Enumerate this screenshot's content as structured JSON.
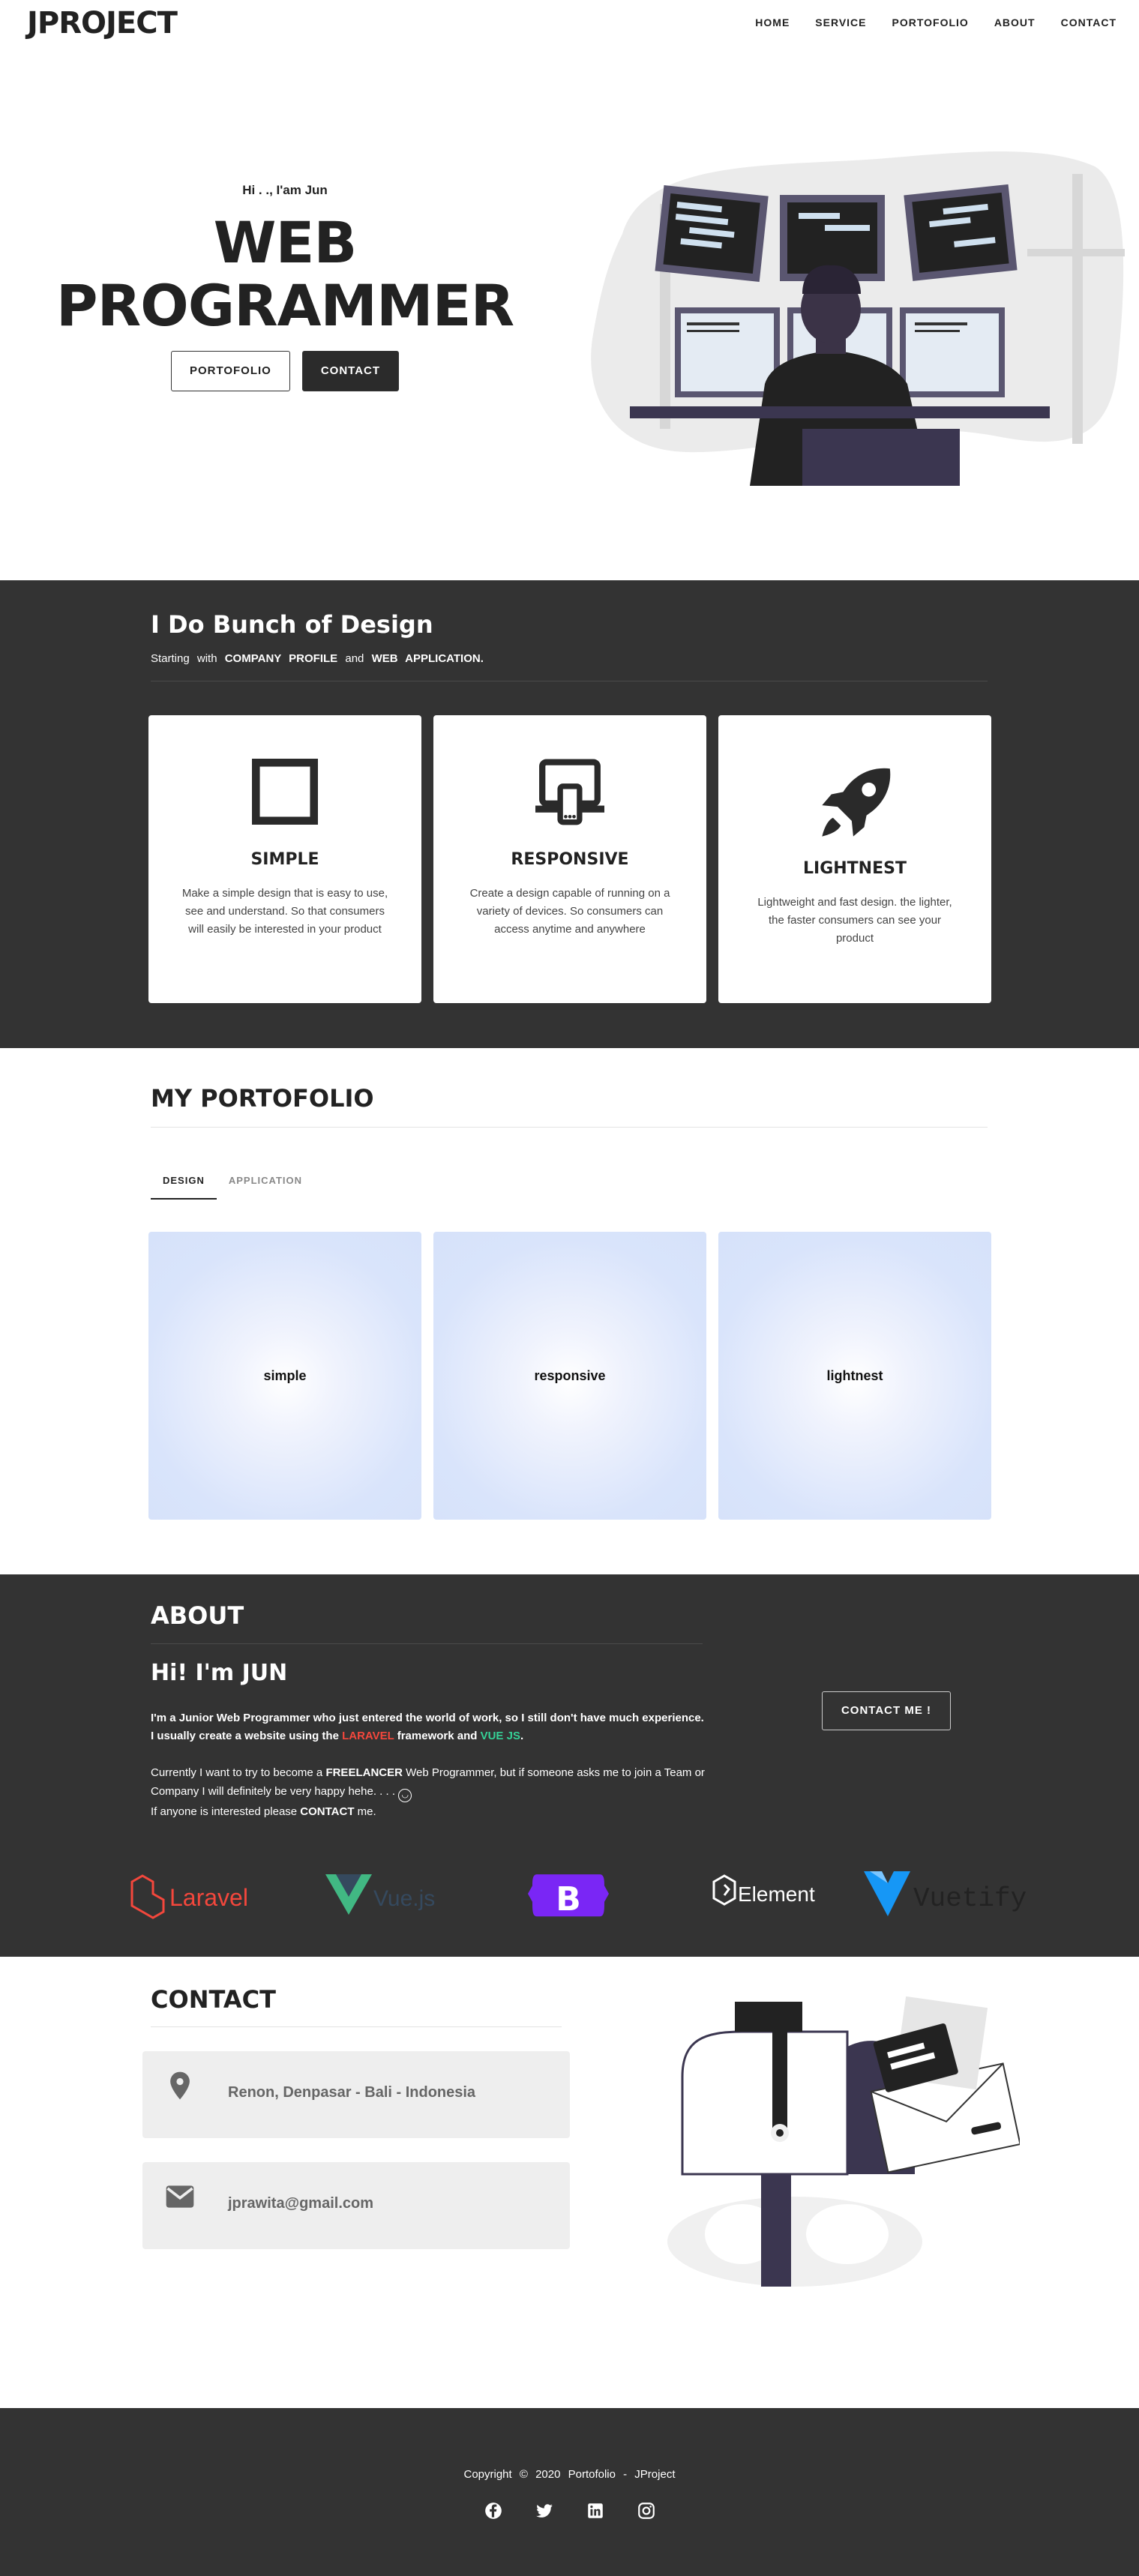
{
  "nav": {
    "logo": "JPROJECT",
    "items": [
      "HOME",
      "SERVICE",
      "PORTOFOLIO",
      "ABOUT",
      "CONTACT"
    ]
  },
  "hero": {
    "greeting": "Hi . ., I'am Jun",
    "title_line1": "WEB",
    "title_line2": "PROGRAMMER",
    "btn_portfolio": "PORTOFOLIO",
    "btn_contact": "CONTACT"
  },
  "services": {
    "title": "I Do Bunch of Design",
    "sub_start": "Starting with",
    "sub_b1": "COMPANY PROFILE",
    "sub_and": "and",
    "sub_b2": "WEB APPLICATION",
    "sub_end": ".",
    "cards": [
      {
        "title": "SIMPLE",
        "text": "Make a simple design that is easy to use, see and understand. So that consumers will easily be interested in your product",
        "icon": "square-icon"
      },
      {
        "title": "RESPONSIVE",
        "text": "Create a design capable of running on a variety of devices. So consumers can access anytime and anywhere",
        "icon": "devices-icon"
      },
      {
        "title": "LIGHTNEST",
        "text": "Lightweight and fast design. the lighter, the faster consumers can see your product",
        "icon": "rocket-icon"
      }
    ]
  },
  "portfolio": {
    "title": "MY PORTOFOLIO",
    "tabs": [
      "DESIGN",
      "APPLICATION"
    ],
    "items": [
      "simple",
      "responsive",
      "lightnest"
    ]
  },
  "about": {
    "title": "ABOUT",
    "heading": "Hi! I'm JUN",
    "p1_a": "I'm a Junior Web Programmer who just entered the world of work, so I still don't have much experience. I usually create a website using the ",
    "p1_laravel": "LARAVEL",
    "p1_b": " framework and ",
    "p1_vue": "VUE JS",
    "p1_c": ".",
    "p2_a": "Currently I want to try to become a ",
    "p2_free": "FREELANCER",
    "p2_b": " Web Programmer, but if someone asks me to join a Team or Company I will definitely be very happy hehe. . . . ",
    "p2_c": "If anyone is interested please ",
    "p2_contact": "CONTACT",
    "p2_d": " me.",
    "button": "CONTACT ME !",
    "logos": [
      "Laravel",
      "Vue.js",
      "B",
      "Element",
      "Vuetify"
    ],
    "colors": {
      "laravel": "#f4473c",
      "vue_green": "#41b883",
      "vue_dark": "#35495e",
      "bootstrap": "#7a26f5",
      "vuetify": "#1697f6"
    }
  },
  "contact": {
    "title": "CONTACT",
    "address": "Renon, Denpasar - Bali - Indonesia",
    "email": "jprawita@gmail.com"
  },
  "footer": {
    "copyright": "Copyright © 2020 Portofolio - JProject",
    "social": [
      "facebook-icon",
      "twitter-icon",
      "linkedin-icon",
      "instagram-icon"
    ]
  }
}
